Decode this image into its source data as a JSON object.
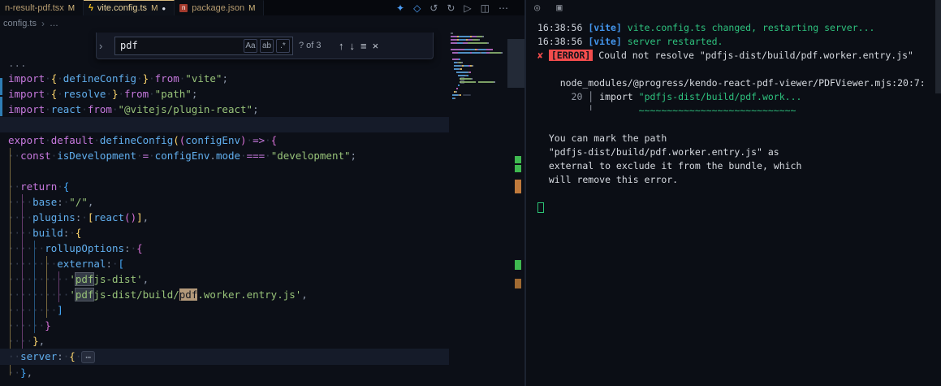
{
  "colors": {
    "background": "#0b0e15",
    "tab_bar_background": "#06080d",
    "accent_blue": "#4395ec",
    "modified_gold": "#d7ba7d",
    "error_red": "#f14c4c",
    "terminal_green": "#2ec27e",
    "keyword_pink": "#c678dd",
    "string_green": "#98c379",
    "identifier_blue": "#61afef",
    "bracket_gold": "#ffd76e",
    "bracket_orchid": "#d670d6",
    "bracket_blue": "#45a9f9",
    "git_modified_blue": "#2f7eb5",
    "overview_green": "#3fb950",
    "overview_orange": "#c07a3c"
  },
  "tabs": [
    {
      "label": "n-result-pdf.tsx",
      "badge": "M"
    },
    {
      "label": "vite.config.ts",
      "badge": "M",
      "dirty": "●",
      "icon_glyph": "ϟ"
    },
    {
      "label": "package.json",
      "badge": "M",
      "icon_glyph": "n"
    }
  ],
  "editor_actions": [
    {
      "name": "format-icon",
      "glyph": "✦",
      "color": "#4d9ef7"
    },
    {
      "name": "beaker-icon",
      "glyph": "◇",
      "color": "#4d9ef7"
    },
    {
      "name": "undo-icon",
      "glyph": "↺",
      "color": "#8a93a2"
    },
    {
      "name": "redo-icon",
      "glyph": "↻",
      "color": "#8a93a2"
    },
    {
      "name": "run-icon",
      "glyph": "▷",
      "color": "#8a93a2"
    },
    {
      "name": "split-editor-icon",
      "glyph": "◫",
      "color": "#8a93a2"
    },
    {
      "name": "more-actions-icon",
      "glyph": "⋯",
      "color": "#8a93a2"
    }
  ],
  "breadcrumb": {
    "file": "config.ts",
    "sep": "›",
    "more": "…"
  },
  "find": {
    "chevron": "›",
    "query": "pdf",
    "case_toggle": "Aa",
    "word_toggle": "ab",
    "regex_toggle": ".*",
    "count": "? of 3",
    "prev_icon": "↑",
    "next_icon": "↓",
    "selection_icon": "≡",
    "close_icon": "×"
  },
  "code": {
    "lines": [
      {
        "s": [
          [
            "fold",
            "..."
          ]
        ]
      },
      {
        "s": [
          [
            "kw",
            "import "
          ],
          [
            "b1",
            "{ "
          ],
          [
            "var",
            "defineConfig "
          ],
          [
            "b1",
            "} "
          ],
          [
            "kw",
            "from "
          ],
          [
            "str",
            "\"vite\""
          ],
          [
            "pun",
            ";"
          ]
        ]
      },
      {
        "s": [
          [
            "kw",
            "import "
          ],
          [
            "b1",
            "{ "
          ],
          [
            "var",
            "resolve "
          ],
          [
            "b1",
            "} "
          ],
          [
            "kw",
            "from "
          ],
          [
            "str",
            "\"path\""
          ],
          [
            "pun",
            ";"
          ]
        ]
      },
      {
        "s": [
          [
            "kw",
            "import "
          ],
          [
            "var",
            "react "
          ],
          [
            "kw",
            "from "
          ],
          [
            "str",
            "\"@vitejs/plugin-react\""
          ],
          [
            "pun",
            ";"
          ]
        ]
      },
      {
        "hl": true,
        "s": []
      },
      {
        "s": [
          [
            "kw",
            "export default "
          ],
          [
            "var",
            "defineConfig"
          ],
          [
            "b1",
            "("
          ],
          [
            "b2",
            "("
          ],
          [
            "var",
            "configEnv"
          ],
          [
            "b2",
            ")"
          ],
          [
            "op",
            " => "
          ],
          [
            "b2",
            "{"
          ]
        ]
      },
      {
        "s": [
          [
            "ws",
            "  "
          ],
          [
            "kw",
            "const "
          ],
          [
            "var",
            "isDevelopment "
          ],
          [
            "op",
            "= "
          ],
          [
            "var",
            "configEnv"
          ],
          [
            "pun",
            "."
          ],
          [
            "prop",
            "mode "
          ],
          [
            "op",
            "=== "
          ],
          [
            "str",
            "\"development\""
          ],
          [
            "pun",
            ";"
          ]
        ]
      },
      {
        "s": []
      },
      {
        "s": [
          [
            "ws",
            "  "
          ],
          [
            "kw",
            "return "
          ],
          [
            "b3",
            "{"
          ]
        ]
      },
      {
        "s": [
          [
            "ws",
            "    "
          ],
          [
            "prop",
            "base"
          ],
          [
            "pun",
            ": "
          ],
          [
            "str",
            "\"/\""
          ],
          [
            "pun",
            ","
          ]
        ]
      },
      {
        "s": [
          [
            "ws",
            "    "
          ],
          [
            "prop",
            "plugins"
          ],
          [
            "pun",
            ": "
          ],
          [
            "b1",
            "["
          ],
          [
            "var",
            "react"
          ],
          [
            "b2",
            "()"
          ],
          [
            "b1",
            "]"
          ],
          [
            "pun",
            ","
          ]
        ]
      },
      {
        "s": [
          [
            "ws",
            "    "
          ],
          [
            "prop",
            "build"
          ],
          [
            "pun",
            ": "
          ],
          [
            "b1",
            "{"
          ]
        ]
      },
      {
        "s": [
          [
            "ws",
            "      "
          ],
          [
            "prop",
            "rollupOptions"
          ],
          [
            "pun",
            ": "
          ],
          [
            "b2",
            "{"
          ]
        ]
      },
      {
        "s": [
          [
            "ws",
            "        "
          ],
          [
            "prop",
            "external"
          ],
          [
            "pun",
            ": "
          ],
          [
            "b3",
            "["
          ]
        ]
      },
      {
        "s": [
          [
            "ws",
            "          "
          ],
          [
            "str",
            "'"
          ],
          [
            "match",
            "pdf"
          ],
          [
            "str",
            "js-dist'"
          ],
          [
            "pun",
            ","
          ]
        ]
      },
      {
        "s": [
          [
            "ws",
            "          "
          ],
          [
            "str",
            "'"
          ],
          [
            "match",
            "pdf"
          ],
          [
            "str",
            "js-dist/build/"
          ],
          [
            "matchsel",
            "pdf"
          ],
          [
            "str",
            ".worker.entry.js'"
          ],
          [
            "pun",
            ","
          ]
        ]
      },
      {
        "s": [
          [
            "ws",
            "        "
          ],
          [
            "b3",
            "]"
          ]
        ]
      },
      {
        "s": [
          [
            "ws",
            "      "
          ],
          [
            "b2",
            "}"
          ]
        ]
      },
      {
        "s": [
          [
            "ws",
            "    "
          ],
          [
            "b1",
            "}"
          ],
          [
            "pun",
            ","
          ]
        ]
      },
      {
        "hl": true,
        "s": [
          [
            "ws",
            "  "
          ],
          [
            "prop",
            "server"
          ],
          [
            "pun",
            ": "
          ],
          [
            "b1",
            "{"
          ],
          [
            "ws",
            " "
          ],
          [
            "foldbox",
            "⋯"
          ]
        ]
      },
      {
        "s": [
          [
            "ws",
            "  "
          ],
          [
            "b3",
            "}"
          ],
          [
            "pun",
            ","
          ]
        ]
      }
    ]
  },
  "terminal": {
    "icons": [
      {
        "name": "terminal-status-icon",
        "glyph": "◎"
      },
      {
        "name": "terminal-panel-icon",
        "glyph": "▣"
      }
    ],
    "lines": [
      {
        "s": [
          [
            "tm",
            "16:38:56 "
          ],
          [
            "vt",
            "[vite]"
          ],
          [
            "grn",
            " vite.config.ts changed, restarting server..."
          ]
        ]
      },
      {
        "s": [
          [
            "tm",
            "16:38:56 "
          ],
          [
            "vt",
            "[vite]"
          ],
          [
            "grn",
            " server restarted."
          ]
        ]
      },
      {
        "s": [
          [
            "err",
            "✘ "
          ],
          [
            "errbadge",
            "[ERROR]"
          ],
          [
            "wht",
            " Could not resolve \"pdfjs-dist/build/pdf.worker.entry.js\""
          ]
        ]
      },
      {
        "s": []
      },
      {
        "s": [
          [
            "wht",
            "    node_modules/@progress/kendo-react-pdf-viewer/PDFViewer.mjs:20:7:"
          ]
        ]
      },
      {
        "s": [
          [
            "dim",
            "      20 │ "
          ],
          [
            "wht",
            "import "
          ],
          [
            "grn",
            "\"pdfjs-dist/build/pdf.work..."
          ]
        ]
      },
      {
        "s": [
          [
            "dim",
            "         ╵        "
          ],
          [
            "grn",
            "~~~~~~~~~~~~~~~~~~~~~~~~~~~~"
          ]
        ]
      },
      {
        "s": []
      },
      {
        "s": [
          [
            "wht",
            "  You can mark the path"
          ]
        ]
      },
      {
        "s": [
          [
            "wht",
            "  \"pdfjs-dist/build/pdf.worker.entry.js\" as"
          ]
        ]
      },
      {
        "s": [
          [
            "wht",
            "  external to exclude it from the bundle, which"
          ]
        ]
      },
      {
        "s": [
          [
            "wht",
            "  will remove this error."
          ]
        ]
      },
      {
        "s": []
      },
      {
        "cursor": true
      }
    ]
  }
}
